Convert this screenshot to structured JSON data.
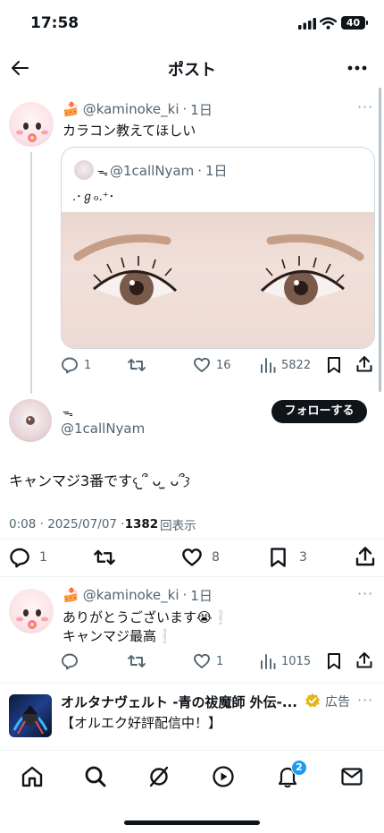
{
  "status_bar": {
    "time": "17:58",
    "battery": "40"
  },
  "header": {
    "title": "ポスト"
  },
  "reply_tweet": {
    "handle": "@kaminoke_ki",
    "time": "1日",
    "text": "カラコン教えてほしい",
    "quote": {
      "name_glyph": "ᯓ",
      "handle": "@1callNyam",
      "time": "1日",
      "text": ".･ℊℴ.⁺･"
    },
    "stats": {
      "replies": "1",
      "retweets": "",
      "likes": "16",
      "views": "5822"
    }
  },
  "main_tweet": {
    "name_glyph": "ᯓ",
    "handle": "@1callNyam",
    "follow_label": "フォローする",
    "text": "キャンマジ3番です𐔌՞ ᴗ ̫ ᴗ՞𐦯",
    "date": "0:08 · 2025/07/07 · ",
    "views_count": "1382",
    "views_label": "回表示",
    "actions": {
      "replies": "1",
      "retweets": "",
      "likes": "8",
      "bookmarks": "3"
    }
  },
  "reply2": {
    "handle": "@kaminoke_ki",
    "time": "1日",
    "line1": "ありがとうございます😭❕",
    "line2": "キャンマジ最高❕",
    "stats": {
      "replies": "",
      "retweets": "",
      "likes": "1",
      "views": "1015"
    }
  },
  "ad": {
    "title": "オルタナヴェルト -青の祓魔師 外伝-...",
    "ad_label": "広告",
    "text": "【オルエク好評配信中！】"
  },
  "bottom_nav": {
    "notification_count": "2"
  },
  "icons": [
    "back-arrow-icon",
    "more-icon",
    "reply-icon",
    "retweet-icon",
    "like-icon",
    "views-icon",
    "bookmark-icon",
    "share-icon",
    "home-icon",
    "search-icon",
    "grok-icon",
    "video-icon",
    "bell-icon",
    "mail-icon",
    "verified-icon"
  ],
  "colors": {
    "accent": "#1d9bf0",
    "text": "#0f1419",
    "muted": "#536471"
  }
}
